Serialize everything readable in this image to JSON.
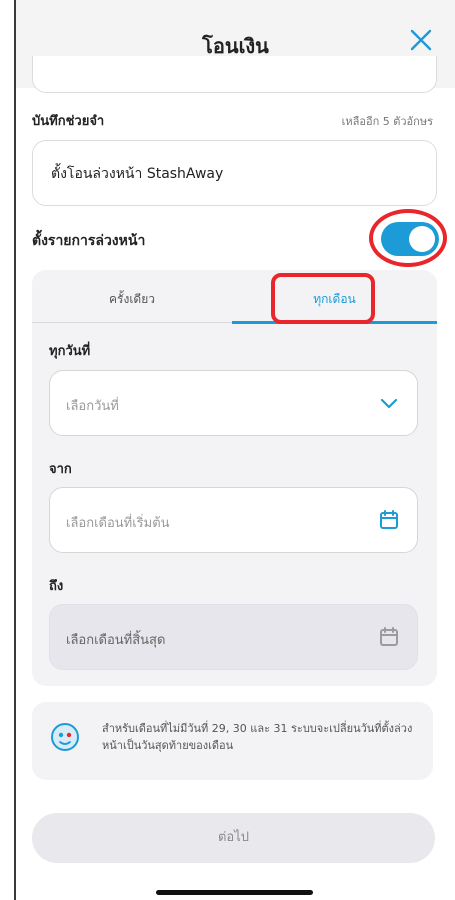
{
  "header": {
    "title": "โอนเงิน",
    "close_icon": "close-icon"
  },
  "memo": {
    "label": "บันทึกช่วยจำ",
    "limit": "เหลืออีก 5 ตัวอักษร",
    "value": "ตั้งโอนล่วงหน้า StashAway"
  },
  "schedule": {
    "label": "ตั้งรายการล่วงหน้า",
    "toggle_on": true,
    "accent": "#1d9bd6",
    "tabs": [
      {
        "label": "ครั้งเดียว",
        "selected": false
      },
      {
        "label": "ทุกเดือน",
        "selected": true
      }
    ]
  },
  "form": {
    "day": {
      "label": "ทุกวันที่",
      "placeholder": "เลือกวันที่",
      "icon": "chevron-down-icon"
    },
    "from": {
      "label": "จาก",
      "placeholder": "เลือกเดือนที่เริ่มต้น",
      "icon": "calendar-icon"
    },
    "to": {
      "label": "ถึง",
      "placeholder": "เลือกเดือนที่สิ้นสุด",
      "icon": "calendar-icon",
      "disabled": true
    }
  },
  "note": {
    "icon": "mascot-icon",
    "text": "สำหรับเดือนที่ไม่มีวันที่ 29, 30 และ 31 ระบบจะเปลี่ยนวันที่ตั้งล่วงหน้าเป็นวันสุดท้ายของเดือน"
  },
  "footer": {
    "next_label": "ต่อไป"
  },
  "highlight_color": "#e8262b"
}
